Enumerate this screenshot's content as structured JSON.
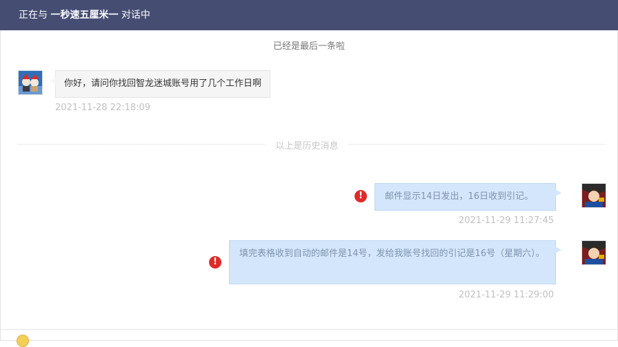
{
  "header": {
    "prefix": "正在与",
    "nickname": "一秒速五厘米一",
    "suffix": "对话中",
    "background": "#454d73"
  },
  "notices": {
    "last_message": "已经是最后一条啦",
    "history_divider": "以上是历史消息"
  },
  "messages": [
    {
      "side": "left",
      "text": "你好，请问你找回智龙迷城账号用了几个工作日啊",
      "time": "2021-11-28 22:18:09"
    },
    {
      "side": "right",
      "text": "邮件显示14日发出，16日收到引记。",
      "time": "2021-11-29 11:27:45",
      "status": "failed"
    },
    {
      "side": "right",
      "text": "填完表格收到自动的邮件是14号，发给我账号找回的引记是16号（星期六）。",
      "time": "2021-11-29 11:29:00",
      "status": "failed"
    }
  ],
  "icons": {
    "error": "exclamation-circle-icon",
    "emoji": "smiley-icon"
  },
  "colors": {
    "sent_bubble": "#d4e6fb",
    "received_bubble": "#f5f5f5",
    "error": "#e02a2a"
  }
}
